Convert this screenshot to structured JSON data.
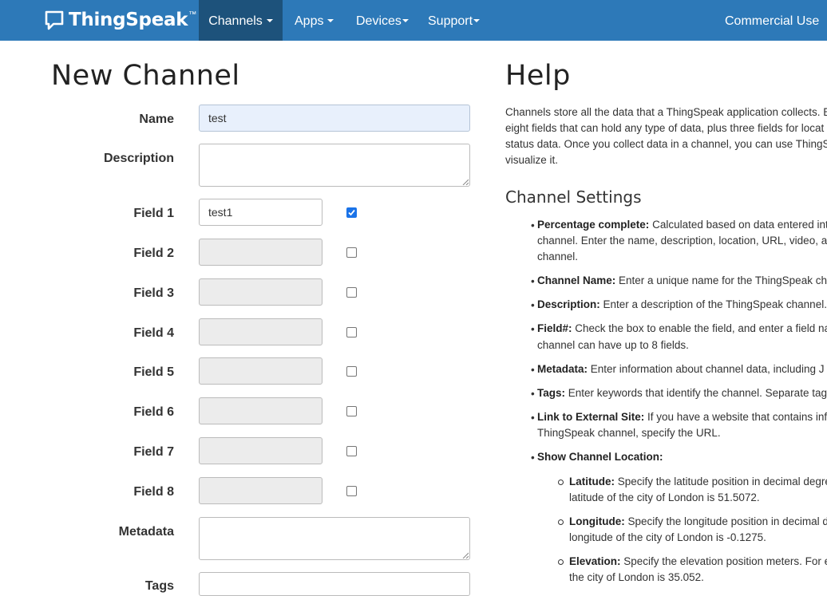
{
  "navbar": {
    "brand": "ThingSpeak",
    "brand_tm": "™",
    "items": [
      {
        "label": "Channels"
      },
      {
        "label": "Apps"
      },
      {
        "label": "Devices"
      },
      {
        "label": "Support"
      }
    ],
    "commercial": "Commercial Use"
  },
  "form": {
    "title": "New Channel",
    "name_label": "Name",
    "name_value": "test",
    "description_label": "Description",
    "fields": [
      {
        "label": "Field 1",
        "value": "test1",
        "checked": true
      },
      {
        "label": "Field 2",
        "value": "",
        "checked": false
      },
      {
        "label": "Field 3",
        "value": "",
        "checked": false
      },
      {
        "label": "Field 4",
        "value": "",
        "checked": false
      },
      {
        "label": "Field 5",
        "value": "",
        "checked": false
      },
      {
        "label": "Field 6",
        "value": "",
        "checked": false
      },
      {
        "label": "Field 7",
        "value": "",
        "checked": false
      },
      {
        "label": "Field 8",
        "value": "",
        "checked": false
      }
    ],
    "metadata_label": "Metadata",
    "tags_label": "Tags"
  },
  "help": {
    "title": "Help",
    "intro": [
      "Channels store all the data that a ThingSpeak application collects. E",
      "eight fields that can hold any type of data, plus three fields for locat",
      "status data. Once you collect data in a channel, you can use ThingSp",
      "visualize it."
    ],
    "settings_title": "Channel Settings",
    "items": [
      {
        "term": "Percentage complete:",
        "lines": [
          " Calculated based on data entered into",
          "channel. Enter the name, description, location, URL, video, a",
          "channel."
        ]
      },
      {
        "term": "Channel Name:",
        "lines": [
          " Enter a unique name for the ThingSpeak cha"
        ]
      },
      {
        "term": "Description:",
        "lines": [
          " Enter a description of the ThingSpeak channel."
        ]
      },
      {
        "term": "Field#:",
        "lines": [
          " Check the box to enable the field, and enter a field na",
          "channel can have up to 8 fields."
        ]
      },
      {
        "term": "Metadata:",
        "lines": [
          " Enter information about channel data, including J"
        ]
      },
      {
        "term": "Tags:",
        "lines": [
          " Enter keywords that identify the channel. Separate tags"
        ]
      },
      {
        "term": "Link to External Site:",
        "lines": [
          " If you have a website that contains infor",
          "ThingSpeak channel, specify the URL."
        ]
      },
      {
        "term": "Show Channel Location:",
        "lines": [
          ""
        ]
      }
    ],
    "sub_items": [
      {
        "term": "Latitude:",
        "lines": [
          " Specify the latitude position in decimal degre",
          "latitude of the city of London is 51.5072."
        ]
      },
      {
        "term": "Longitude:",
        "lines": [
          " Specify the longitude position in decimal d",
          "longitude of the city of London is -0.1275."
        ]
      },
      {
        "term": "Elevation:",
        "lines": [
          " Specify the elevation position meters. For ex",
          "the city of London is 35.052."
        ]
      }
    ]
  }
}
